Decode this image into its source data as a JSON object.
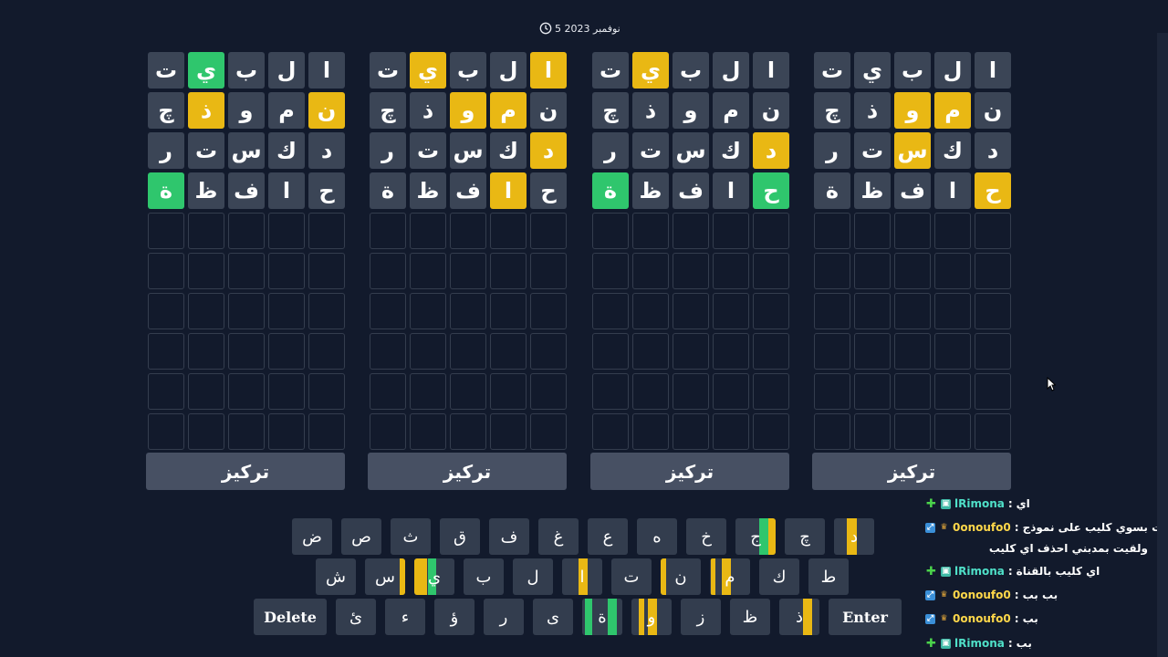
{
  "header": {
    "date": "5 نوفمبر 2023"
  },
  "boards": [
    {
      "rows": [
        [
          "ا",
          "l"
        ],
        [
          "ل",
          "l"
        ],
        [
          "ب",
          "l"
        ],
        [
          "ي",
          "l"
        ],
        [
          "ت",
          "l"
        ]
      ]
    },
    {
      "rows": []
    },
    {
      "rows": []
    },
    {
      "rows": []
    }
  ],
  "board_words": [
    [
      [
        [
          "ا",
          ""
        ],
        [
          "ل",
          ""
        ],
        [
          "ب",
          ""
        ],
        [
          "ي",
          ""
        ],
        [
          "ت",
          ""
        ]
      ],
      [
        [
          "ن",
          ""
        ],
        [
          "م",
          "y"
        ],
        [
          "و",
          "y"
        ],
        [
          "ذ",
          ""
        ],
        [
          "چ",
          ""
        ]
      ],
      [
        [
          "د",
          ""
        ],
        [
          "ك",
          ""
        ],
        [
          "س",
          "y"
        ],
        [
          "ت",
          ""
        ],
        [
          "ر",
          ""
        ]
      ],
      [
        [
          "ح",
          "y"
        ],
        [
          "ا",
          ""
        ],
        [
          "ف",
          ""
        ],
        [
          "ظ",
          ""
        ],
        [
          "ة",
          ""
        ]
      ]
    ],
    [
      [
        [
          "ا",
          ""
        ],
        [
          "ل",
          ""
        ],
        [
          "ب",
          ""
        ],
        [
          "ي",
          "y"
        ],
        [
          "ت",
          ""
        ]
      ],
      [
        [
          "ن",
          ""
        ],
        [
          "م",
          ""
        ],
        [
          "و",
          ""
        ],
        [
          "ذ",
          ""
        ],
        [
          "چ",
          ""
        ]
      ],
      [
        [
          "د",
          "y"
        ],
        [
          "ك",
          ""
        ],
        [
          "س",
          ""
        ],
        [
          "ت",
          ""
        ],
        [
          "ر",
          ""
        ]
      ],
      [
        [
          "ح",
          "g"
        ],
        [
          "ا",
          ""
        ],
        [
          "ف",
          ""
        ],
        [
          "ظ",
          ""
        ],
        [
          "ة",
          "g"
        ]
      ]
    ],
    [
      [
        [
          "ا",
          "y"
        ],
        [
          "ل",
          ""
        ],
        [
          "ب",
          ""
        ],
        [
          "ي",
          "y"
        ],
        [
          "ت",
          ""
        ]
      ],
      [
        [
          "ن",
          ""
        ],
        [
          "م",
          "y"
        ],
        [
          "و",
          "y"
        ],
        [
          "ذ",
          ""
        ],
        [
          "چ",
          ""
        ]
      ],
      [
        [
          "د",
          "y"
        ],
        [
          "ك",
          ""
        ],
        [
          "س",
          ""
        ],
        [
          "ت",
          ""
        ],
        [
          "ر",
          ""
        ]
      ],
      [
        [
          "ح",
          ""
        ],
        [
          "ا",
          "y"
        ],
        [
          "ف",
          ""
        ],
        [
          "ظ",
          ""
        ],
        [
          "ة",
          ""
        ]
      ]
    ],
    [
      [
        [
          "ا",
          ""
        ],
        [
          "ل",
          ""
        ],
        [
          "ب",
          ""
        ],
        [
          "ي",
          "g"
        ],
        [
          "ت",
          ""
        ]
      ],
      [
        [
          "ن",
          "y"
        ],
        [
          "م",
          ""
        ],
        [
          "و",
          ""
        ],
        [
          "ذ",
          "y"
        ],
        [
          "چ",
          ""
        ]
      ],
      [
        [
          "د",
          ""
        ],
        [
          "ك",
          ""
        ],
        [
          "س",
          ""
        ],
        [
          "ت",
          ""
        ],
        [
          "ر",
          ""
        ]
      ],
      [
        [
          "ح",
          ""
        ],
        [
          "ا",
          ""
        ],
        [
          "ف",
          ""
        ],
        [
          "ظ",
          ""
        ],
        [
          "ة",
          "g"
        ]
      ]
    ]
  ],
  "focus_label": "تركيز",
  "keyboard": {
    "row1": [
      {
        "k": "د",
        "m": [
          [
            "y",
            14,
            25
          ]
        ]
      },
      {
        "k": "چ",
        "m": []
      },
      {
        "k": "ج",
        "m": [
          [
            "g",
            26,
            36
          ],
          [
            "y",
            36,
            47
          ]
        ]
      },
      {
        "k": "خ",
        "m": []
      },
      {
        "k": "ه",
        "m": []
      },
      {
        "k": "ع",
        "m": []
      },
      {
        "k": "غ",
        "m": []
      },
      {
        "k": "ف",
        "m": []
      },
      {
        "k": "ق",
        "m": []
      },
      {
        "k": "ث",
        "m": []
      },
      {
        "k": "ص",
        "m": []
      },
      {
        "k": "ض",
        "m": []
      }
    ],
    "row2": [
      {
        "k": "ط",
        "m": []
      },
      {
        "k": "ك",
        "m": []
      },
      {
        "k": "م",
        "m": [
          [
            "y",
            1,
            6
          ],
          [
            "y",
            13,
            23
          ]
        ]
      },
      {
        "k": "ن",
        "m": [
          [
            "y",
            0,
            6
          ]
        ]
      },
      {
        "k": "ت",
        "m": []
      },
      {
        "k": "ا",
        "m": [
          [
            "y",
            18,
            28
          ]
        ]
      },
      {
        "k": "ل",
        "m": []
      },
      {
        "k": "ب",
        "m": []
      },
      {
        "k": "ي",
        "m": [
          [
            "y",
            0,
            14
          ],
          [
            "g",
            15,
            24
          ]
        ]
      },
      {
        "k": "س",
        "m": [
          [
            "y",
            38,
            44
          ]
        ]
      },
      {
        "k": "ش",
        "m": []
      }
    ],
    "row3": [
      {
        "k": "Enter",
        "wide": true,
        "m": []
      },
      {
        "k": "ذ",
        "m": [
          [
            "y",
            26,
            36
          ]
        ]
      },
      {
        "k": "ظ",
        "m": []
      },
      {
        "k": "ز",
        "m": []
      },
      {
        "k": "و",
        "m": [
          [
            "y",
            8,
            14
          ],
          [
            "y",
            18,
            28
          ]
        ]
      },
      {
        "k": "ة",
        "m": [
          [
            "g",
            3,
            11
          ],
          [
            "g",
            28,
            38
          ]
        ]
      },
      {
        "k": "ى",
        "m": []
      },
      {
        "k": "ر",
        "m": []
      },
      {
        "k": "ؤ",
        "m": []
      },
      {
        "k": "ء",
        "m": []
      },
      {
        "k": "ئ",
        "m": []
      },
      {
        "k": "Delete",
        "wide": true,
        "m": []
      }
    ]
  },
  "chat": [
    {
      "badge": "plus",
      "name": "lRimona",
      "text": "اي"
    },
    {
      "badge": "sq",
      "name": "0onoufo0",
      "text": "رحت بسوي كليب على نموذج"
    },
    {
      "badge": "none",
      "name": "",
      "text": "ولقيت بمدبني احذف اي كليب"
    },
    {
      "badge": "plus",
      "name": "lRimona",
      "text": "اي كليب بالقناة"
    },
    {
      "badge": "sq",
      "name": "0onoufo0",
      "text": "بب بب"
    },
    {
      "badge": "sq",
      "name": "0onoufo0",
      "text": "بب"
    },
    {
      "badge": "plus",
      "name": "lRimona",
      "text": "بب"
    }
  ],
  "colors": {
    "background": "#121a2c",
    "tile": "#3b4556",
    "present": "#e9b814",
    "correct": "#2fc66d",
    "key": "#333d4e"
  }
}
